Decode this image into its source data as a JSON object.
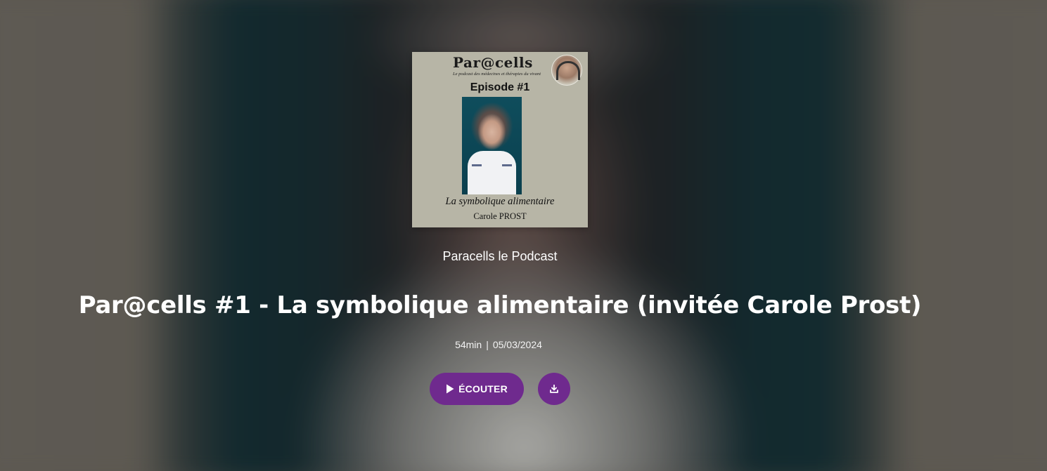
{
  "cover": {
    "brand": "Par@cells",
    "tagline": "Le podcast des médecines et thérapies du vivant",
    "episode": "Episode #1",
    "subtitle": "La symbolique alimentaire",
    "guest": "Carole PROST"
  },
  "podcast": {
    "name": "Paracells le Podcast"
  },
  "episode": {
    "title": "Par@cells #1 - La symbolique alimentaire (invitée Carole Prost)",
    "duration": "54min",
    "separator": "|",
    "date": "05/03/2024"
  },
  "actions": {
    "listen_label": "ÉCOUTER",
    "listen_icon": "play-icon",
    "download_icon": "download-icon"
  },
  "colors": {
    "accent": "#6f2a8e",
    "text": "#ffffff"
  }
}
